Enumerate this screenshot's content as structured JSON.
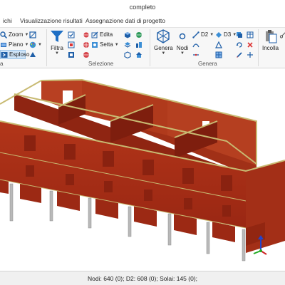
{
  "window": {
    "title": "completo"
  },
  "tabs": [
    "ichi",
    "Visualizzazione risultati",
    "Assegnazione dati di progetto"
  ],
  "ribbon": {
    "view": {
      "zoom": "Zoom",
      "piano": "Piano",
      "esploso": "Esploso"
    },
    "selezione": {
      "label": "Selezione",
      "filtra": "Filtra",
      "edita": "Edita",
      "setta": "Setta"
    },
    "genera": {
      "label": "Genera",
      "genera": "Genera",
      "nodi": "Nodi",
      "d2": "D2",
      "d3": "D3"
    },
    "incolla": "Incolla",
    "left_group_label": "a"
  },
  "status": {
    "text": "Nodi: 640 (0); D2: 608 (0); Solai: 145 (0);"
  },
  "model": {
    "wall_color": "#a82e18",
    "wall_dark": "#7a1c0c",
    "top_color": "#c8ba72",
    "column_color": "#b9b9b9"
  }
}
